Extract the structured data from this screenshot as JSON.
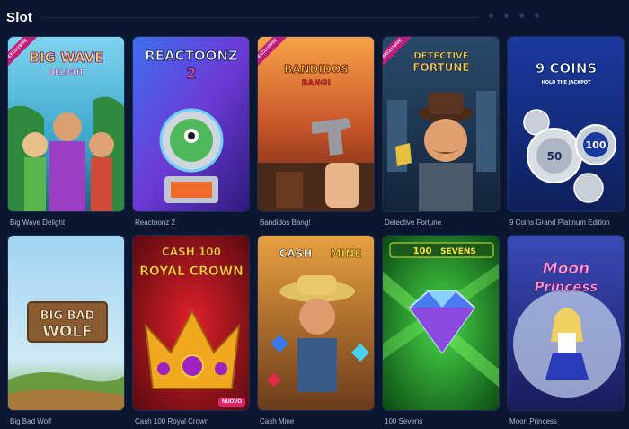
{
  "section": {
    "title": "Slot"
  },
  "pager": {
    "dots": 4
  },
  "badges": {
    "exclusive": "EXCLUSIVE",
    "new": "NUOVO"
  },
  "games": [
    {
      "name": "Big Wave Delight",
      "art_title": "BIG WAVE",
      "art_sub": "DELIGHT",
      "exclusive": true,
      "accent": "#43c26c"
    },
    {
      "name": "Reactoonz 2",
      "art_title": "REACTOONZ",
      "art_sub": "2",
      "exclusive": false,
      "accent": "#5c3bd6"
    },
    {
      "name": "Bandidos Bang!",
      "art_title": "BANDIDOS",
      "art_sub": "BANG!",
      "exclusive": true,
      "accent": "#e8873a"
    },
    {
      "name": "Detective Fortune",
      "art_title": "DETECTIVE",
      "art_sub": "FORTUNE",
      "exclusive": true,
      "accent": "#3a6a92"
    },
    {
      "name": "9 Coins Grand Platinum Edition",
      "art_title": "9 COINS",
      "art_sub": "HOLD THE JACKPOT",
      "exclusive": false,
      "accent": "#2a4fb8"
    },
    {
      "name": "Big Bad Wolf",
      "art_title": "BIG BAD",
      "art_sub": "WOLF",
      "exclusive": false,
      "accent": "#7ab8e0"
    },
    {
      "name": "Cash 100 Royal Crown",
      "art_title": "CASH 100",
      "art_sub": "ROYAL CROWN",
      "exclusive": false,
      "new": true,
      "accent": "#b0171f"
    },
    {
      "name": "Cash Mine",
      "art_title": "CASH",
      "art_sub": "MINE",
      "exclusive": false,
      "accent": "#d6902a"
    },
    {
      "name": "100 Sevens",
      "art_title": "100",
      "art_sub": "SEVENS",
      "exclusive": false,
      "accent": "#1ea83a"
    },
    {
      "name": "Moon Princess",
      "art_title": "Moon",
      "art_sub": "Princess",
      "exclusive": false,
      "accent": "#6b5cd6"
    }
  ]
}
